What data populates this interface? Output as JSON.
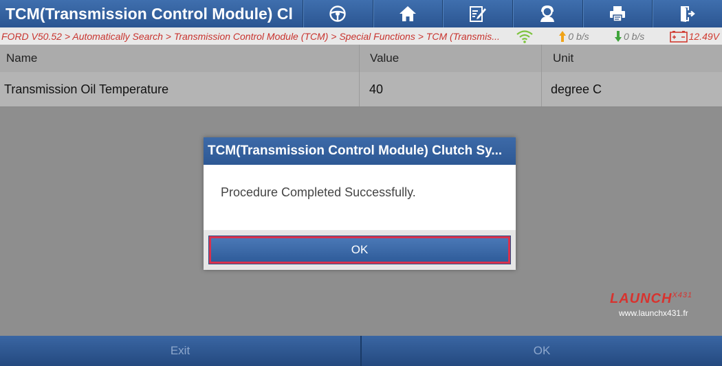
{
  "header": {
    "title": "TCM(Transmission Control Module) Cl",
    "toolbar": [
      {
        "icon": "steering-wheel-icon"
      },
      {
        "icon": "home-icon"
      },
      {
        "icon": "edit-report-icon"
      },
      {
        "icon": "user-support-icon"
      },
      {
        "icon": "printer-icon"
      },
      {
        "icon": "exit-icon"
      }
    ]
  },
  "status": {
    "breadcrumb": "FORD V50.52 > Automatically Search > Transmission Control Module (TCM) > Special Functions > TCM (Transmis...",
    "upload_rate": "0 b/s",
    "download_rate": "0 b/s",
    "voltage": "12.49V"
  },
  "table": {
    "columns": [
      "Name",
      "Value",
      "Unit"
    ],
    "rows": [
      {
        "name": "Transmission Oil Temperature",
        "value": "40",
        "unit": "degree C"
      }
    ]
  },
  "dialog": {
    "title": "TCM(Transmission Control Module) Clutch Sy...",
    "message": "Procedure Completed Successfully.",
    "ok_label": "OK"
  },
  "brand": {
    "name": "LAUNCH",
    "suffix": "X431",
    "url": "www.launchx431.fr"
  },
  "footer": {
    "exit_label": "Exit",
    "ok_label": "OK"
  },
  "colors": {
    "header_blue": "#2b5591",
    "breadcrumb_red": "#c8332e",
    "dialog_highlight": "#d9324d"
  }
}
